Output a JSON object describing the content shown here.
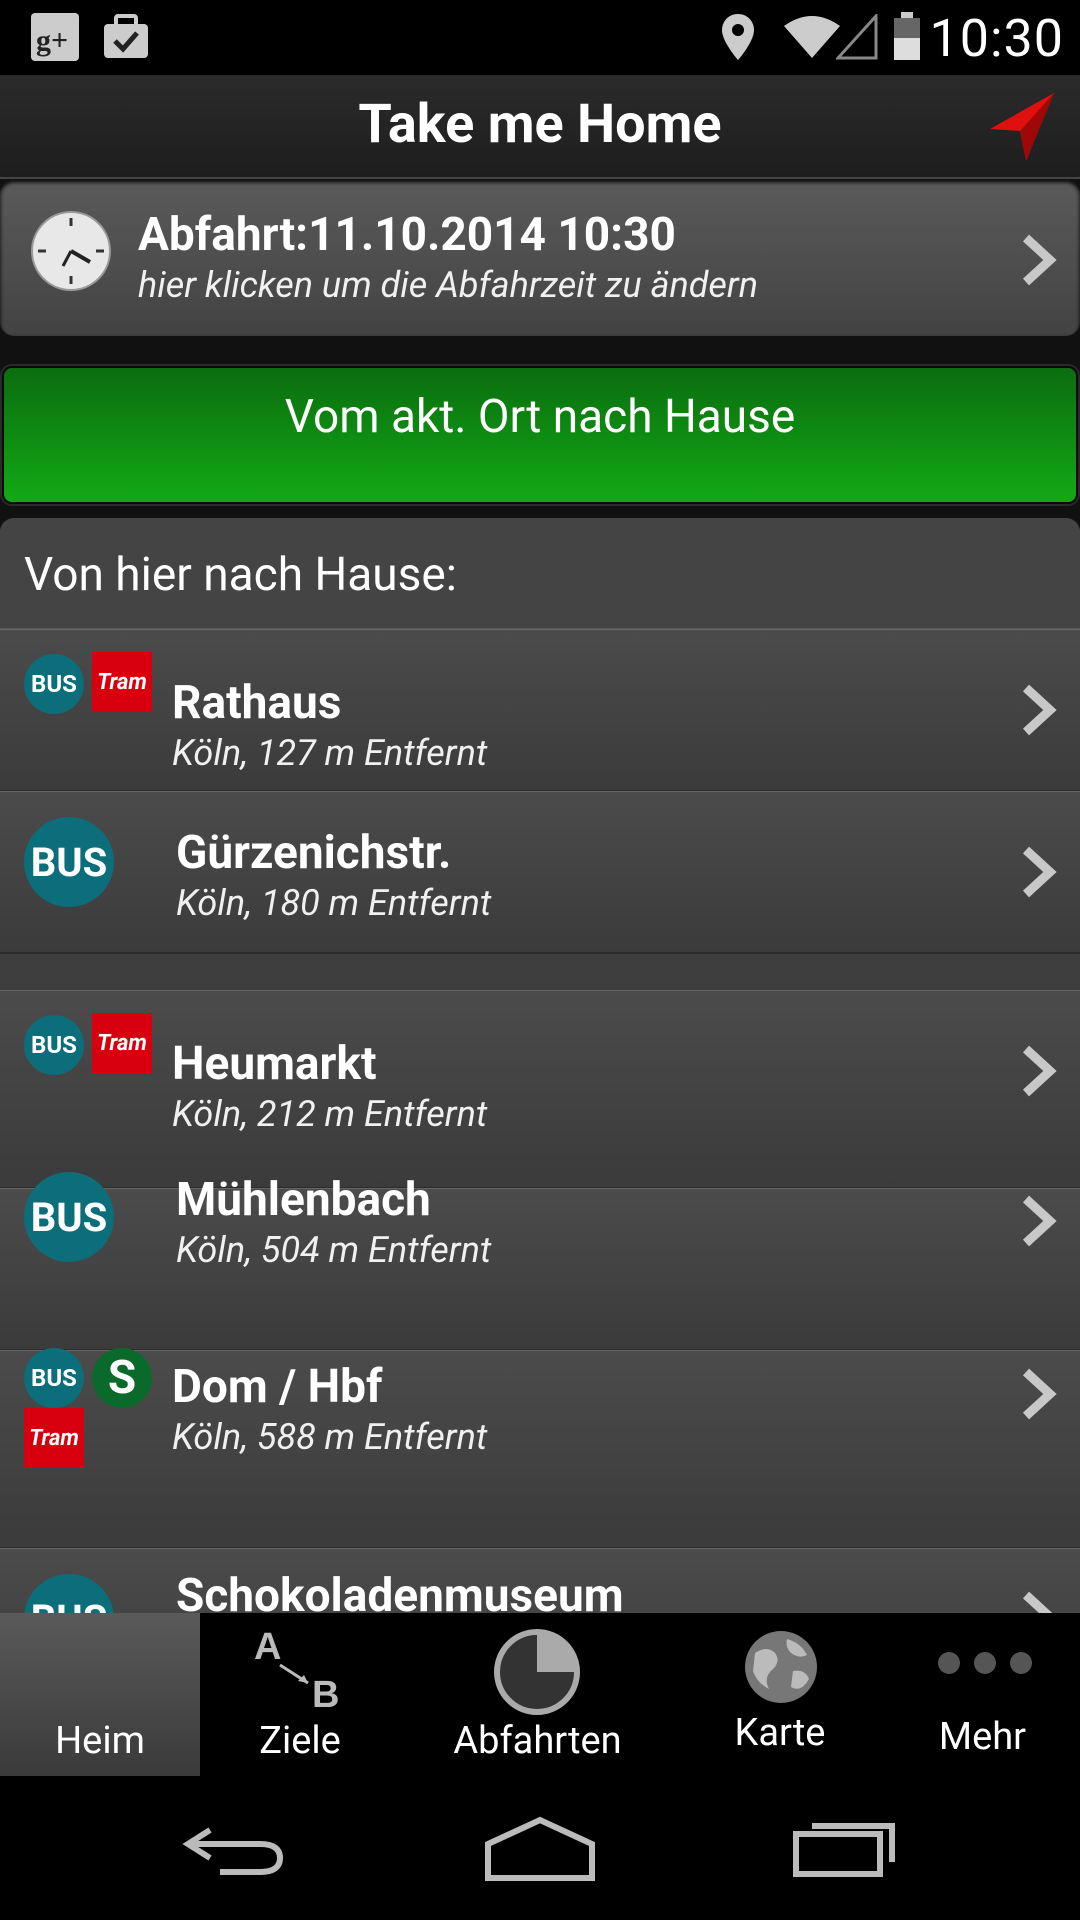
{
  "status_bar": {
    "time": "10:30",
    "icons": [
      "google-plus-icon",
      "briefcase-check-icon",
      "location-pin-icon",
      "wifi-icon",
      "signal-icon",
      "battery-icon"
    ]
  },
  "app_bar": {
    "title": "Take me Home",
    "action_icon": "navigation-arrow-icon",
    "accent_color": "#e01010"
  },
  "departure": {
    "title": "Abfahrt:11.10.2014 10:30",
    "subtitle": "hier klicken um die Abfahrzeit zu ändern"
  },
  "home_button": {
    "label": "Vom akt. Ort nach Hause",
    "color": "#12a915"
  },
  "list": {
    "header": "Von hier nach Hause:",
    "items": [
      {
        "name": "Rathaus",
        "sub": "Köln, 127 m Entfernt",
        "modes": [
          "BUS",
          "Tram"
        ]
      },
      {
        "name": "Gürzenichstr.",
        "sub": "Köln, 180 m Entfernt",
        "modes": [
          "BUS"
        ]
      },
      {
        "name": "Heumarkt",
        "sub": "Köln, 212 m Entfernt",
        "modes": [
          "BUS",
          "Tram"
        ]
      },
      {
        "name": "Mühlenbach",
        "sub": "Köln, 504 m Entfernt",
        "modes": [
          "BUS"
        ]
      },
      {
        "name": "Dom / Hbf",
        "sub": "Köln, 588 m Entfernt",
        "modes": [
          "BUS",
          "S",
          "Tram"
        ]
      },
      {
        "name": "Schokoladenmuseum",
        "sub": "",
        "modes": [
          "BUS"
        ]
      }
    ],
    "badges": {
      "bus": "BUS",
      "tram": "Tram",
      "sbahn": "S"
    }
  },
  "tabs": [
    {
      "label": "Heim",
      "icon": "home-icon",
      "selected": true
    },
    {
      "label": "Ziele",
      "icon": "a-to-b-icon",
      "selected": false
    },
    {
      "label": "Abfahrten",
      "icon": "clock-pie-icon",
      "selected": false
    },
    {
      "label": "Karte",
      "icon": "globe-icon",
      "selected": false
    },
    {
      "label": "Mehr",
      "icon": "more-dots-icon",
      "selected": false
    }
  ],
  "system_nav": [
    "back-icon",
    "home-icon",
    "recents-icon"
  ]
}
